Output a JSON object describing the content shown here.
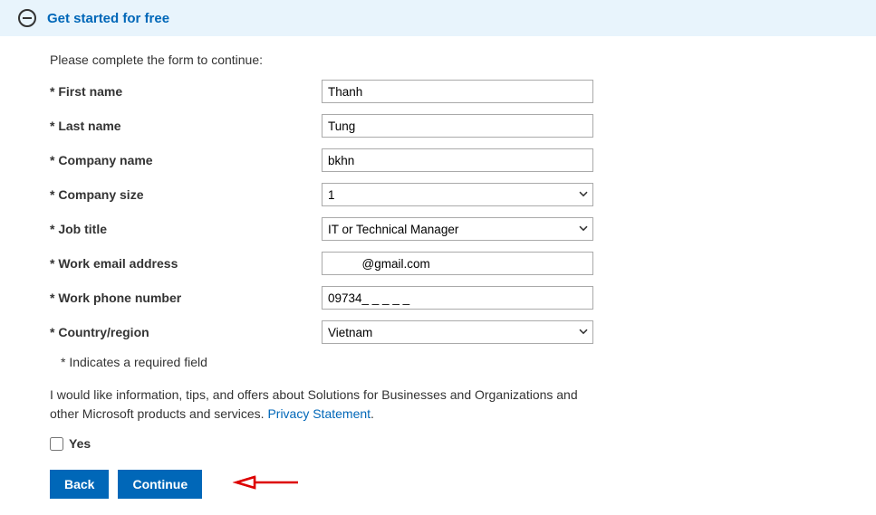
{
  "banner": {
    "title": "Get started for free"
  },
  "form": {
    "instruction": "Please complete the form to continue:",
    "fields": {
      "first_name": {
        "label": "* First name",
        "value": "Thanh"
      },
      "last_name": {
        "label": "* Last name",
        "value": "Tung"
      },
      "company": {
        "label": "* Company name",
        "value": "bkhn"
      },
      "size": {
        "label": "* Company size",
        "value": "1"
      },
      "job": {
        "label": "* Job title",
        "value": "IT or Technical Manager"
      },
      "email": {
        "label": "* Work email address",
        "value": "          @gmail.com"
      },
      "phone": {
        "label": "* Work phone number",
        "value": "09734_ _ _ _ _"
      },
      "country": {
        "label": "* Country/region",
        "value": "Vietnam"
      }
    },
    "required_note": "* Indicates a required field",
    "consent_text_a": "I would like information, tips, and offers about Solutions for Businesses and Organizations and other Microsoft products and services. ",
    "consent_link": "Privacy Statement",
    "consent_text_b": ".",
    "yes_label": "Yes",
    "buttons": {
      "back": "Back",
      "continue": "Continue"
    }
  }
}
